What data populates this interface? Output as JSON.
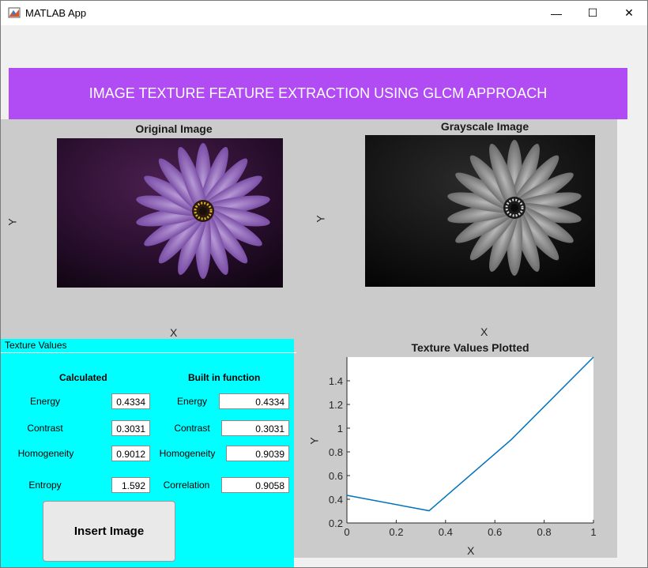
{
  "window": {
    "title": "MATLAB App",
    "minimize": "—",
    "maximize": "☐",
    "close": "✕"
  },
  "banner": {
    "text": "IMAGE TEXTURE FEATURE EXTRACTION USING GLCM APPROACH"
  },
  "axes1": {
    "title": "Original Image",
    "xlabel": "X",
    "ylabel": "Y"
  },
  "axes2": {
    "title": "Grayscale Image",
    "xlabel": "X",
    "ylabel": "Y"
  },
  "texture": {
    "panel_title": "Texture Values",
    "calc_header": "Calculated",
    "builtin_header": "Built in function",
    "calc": [
      {
        "label": "Energy",
        "value": "0.4334"
      },
      {
        "label": "Contrast",
        "value": "0.3031"
      },
      {
        "label": "Homogeneity",
        "value": "0.9012"
      },
      {
        "label": "Entropy",
        "value": "1.592"
      }
    ],
    "builtin": [
      {
        "label": "Energy",
        "value": "0.4334"
      },
      {
        "label": "Contrast",
        "value": "0.3031"
      },
      {
        "label": "Homogeneity",
        "value": "0.9039"
      },
      {
        "label": "Correlation",
        "value": "0.9058"
      }
    ],
    "insert_button": "Insert  Image"
  },
  "chart_data": {
    "type": "line",
    "title": "Texture Values Plotted",
    "xlabel": "X",
    "ylabel": "Y",
    "x": [
      0,
      0.3333,
      0.6667,
      1
    ],
    "series": [
      {
        "values": [
          0.4334,
          0.3031,
          0.9039,
          1.6
        ]
      }
    ],
    "xlim": [
      0,
      1
    ],
    "ylim": [
      0.2,
      1.6
    ],
    "xticks": [
      "0",
      "0.2",
      "0.4",
      "0.6",
      "0.8",
      "1"
    ],
    "yticks": [
      "0.2",
      "0.4",
      "0.6",
      "0.8",
      "1",
      "1.2",
      "1.4"
    ],
    "line_color": "#0072bd",
    "grid": false
  }
}
